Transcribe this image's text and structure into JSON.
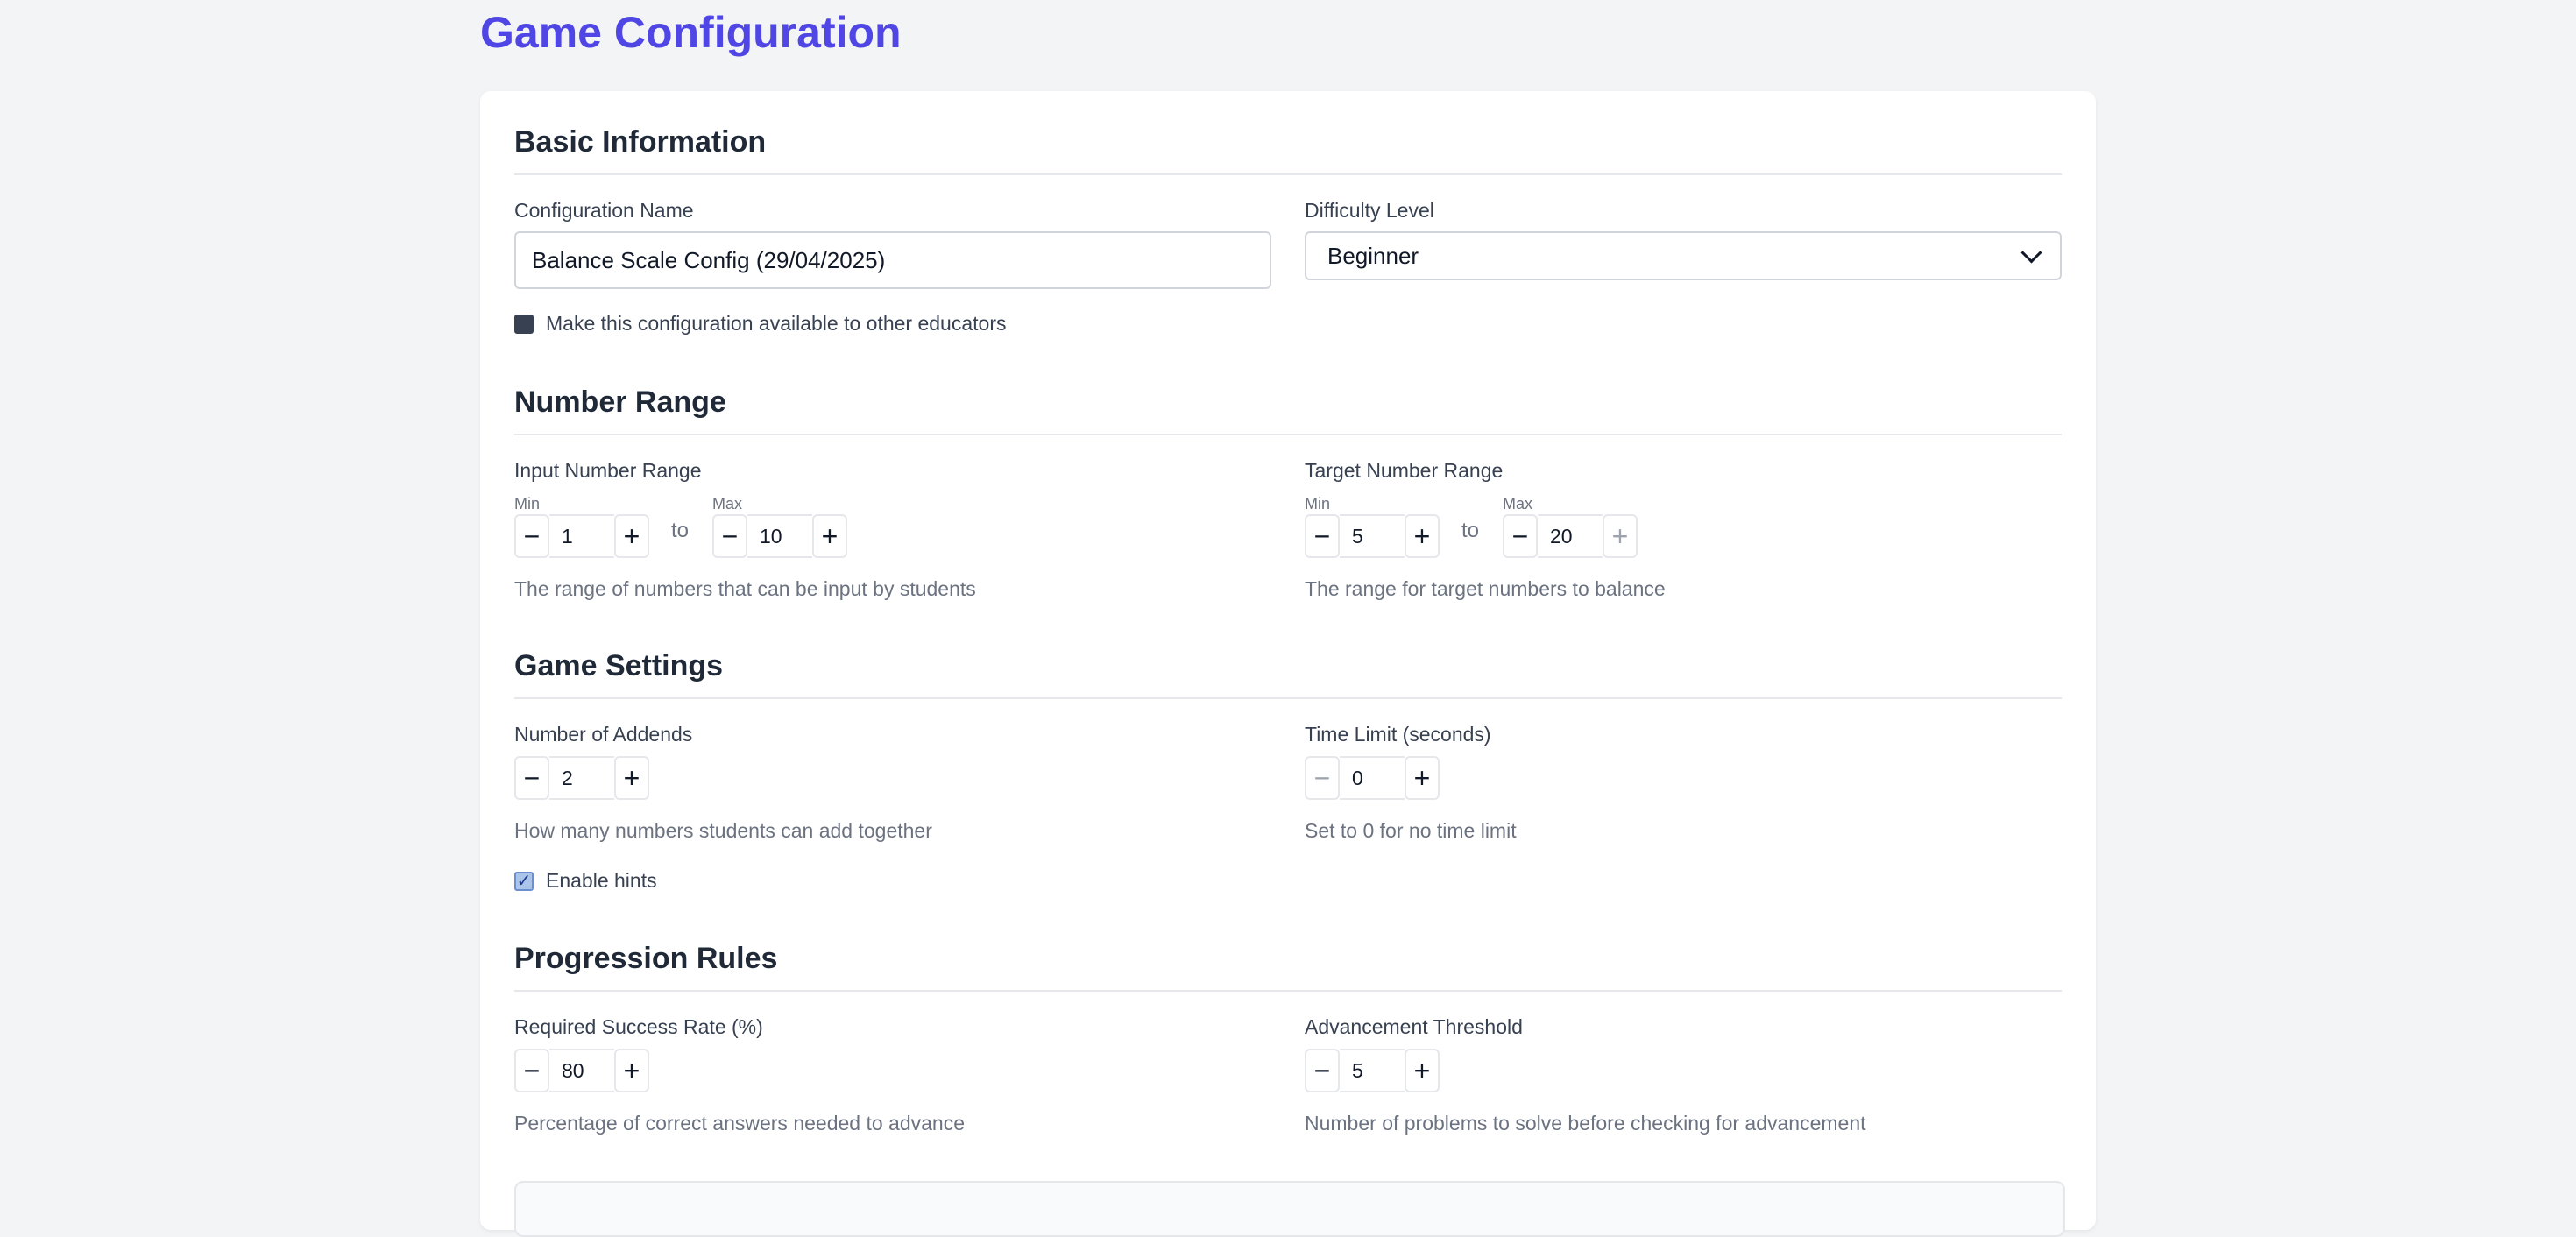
{
  "page_title": "Game Configuration",
  "basic": {
    "title": "Basic Information",
    "config_name_label": "Configuration Name",
    "config_name_value": "Balance Scale Config (29/04/2025)",
    "difficulty_label": "Difficulty Level",
    "difficulty_value": "Beginner",
    "share_label": "Make this configuration available to other educators",
    "share_checked": false
  },
  "number_range": {
    "title": "Number Range",
    "input_label": "Input Number Range",
    "input_min_label": "Min",
    "input_min_value": "1",
    "input_max_label": "Max",
    "input_max_value": "10",
    "to_label": "to",
    "input_help": "The range of numbers that can be input by students",
    "target_label": "Target Number Range",
    "target_min_label": "Min",
    "target_min_value": "5",
    "target_max_label": "Max",
    "target_max_value": "20",
    "target_help": "The range for target numbers to balance"
  },
  "game_settings": {
    "title": "Game Settings",
    "addends_label": "Number of Addends",
    "addends_value": "2",
    "addends_help": "How many numbers students can add together",
    "time_label": "Time Limit (seconds)",
    "time_value": "0",
    "time_help": "Set to 0 for no time limit",
    "hints_label": "Enable hints",
    "hints_checked": true
  },
  "progression": {
    "title": "Progression Rules",
    "success_label": "Required Success Rate (%)",
    "success_value": "80",
    "success_help": "Percentage of correct answers needed to advance",
    "threshold_label": "Advancement Threshold",
    "threshold_value": "5",
    "threshold_help": "Number of problems to solve before checking for advancement"
  },
  "icons": {
    "minus": "−",
    "plus": "+",
    "check": "✓"
  }
}
